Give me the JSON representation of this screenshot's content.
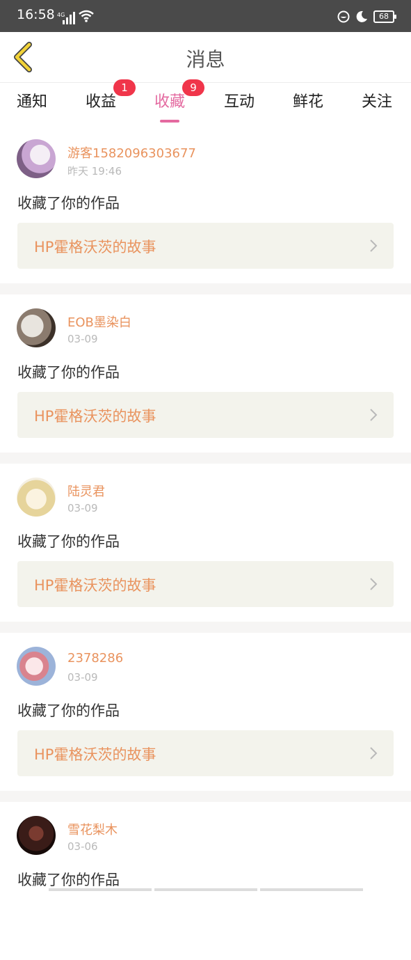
{
  "status": {
    "time": "16:58",
    "network": "4G",
    "battery": "68"
  },
  "header": {
    "title": "消息"
  },
  "tabs": [
    {
      "label": "通知",
      "badge": null
    },
    {
      "label": "收益",
      "badge": "1"
    },
    {
      "label": "收藏",
      "badge": "9",
      "active": true
    },
    {
      "label": "互动",
      "badge": null
    },
    {
      "label": "鲜花",
      "badge": null
    },
    {
      "label": "关注",
      "badge": null
    }
  ],
  "feed": [
    {
      "user": "游客1582096303677",
      "time": "昨天 19:46",
      "action": "收藏了你的作品",
      "work": "HP霍格沃茨的故事"
    },
    {
      "user": "EOB墨染白",
      "time": "03-09",
      "action": "收藏了你的作品",
      "work": "HP霍格沃茨的故事"
    },
    {
      "user": "陆灵君",
      "time": "03-09",
      "action": "收藏了你的作品",
      "work": "HP霍格沃茨的故事"
    },
    {
      "user": "2378286",
      "time": "03-09",
      "action": "收藏了你的作品",
      "work": "HP霍格沃茨的故事"
    },
    {
      "user": "雪花梨木",
      "time": "03-06",
      "action": "收藏了你的作品",
      "work": ""
    }
  ],
  "colors": {
    "accent_pink": "#e46aa0",
    "name_orange": "#e9935e",
    "badge_red": "#f0354a",
    "back_yellow": "#f2d338"
  }
}
